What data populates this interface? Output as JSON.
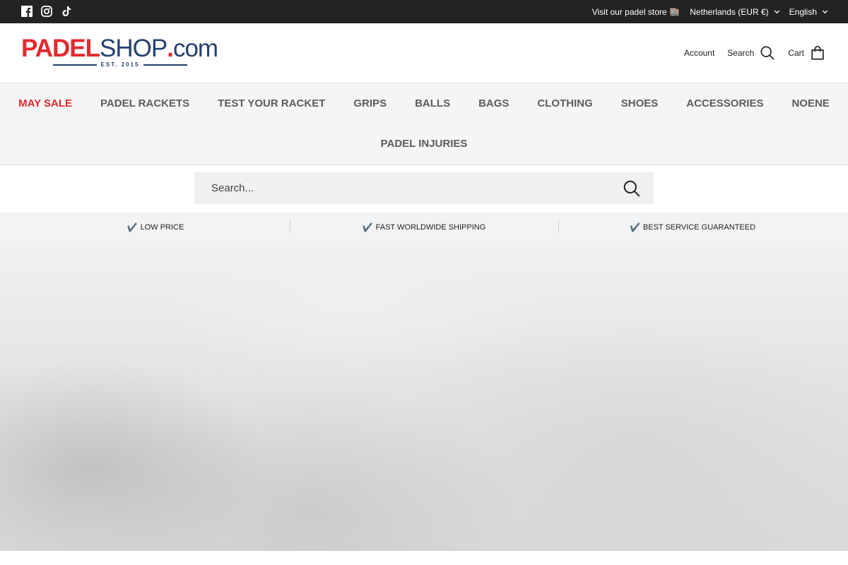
{
  "topbar": {
    "social": [
      "facebook-icon",
      "instagram-icon",
      "tiktok-icon"
    ],
    "store_link": "Visit our padel store",
    "store_emoji": "🏬",
    "country": "Netherlands (EUR €)",
    "language": "English"
  },
  "logo": {
    "padel": "PADEL",
    "shop": "SHOP",
    "dot": ".",
    "com": "com",
    "est": "EST. 2015"
  },
  "header": {
    "account": "Account",
    "search": "Search",
    "cart": "Cart"
  },
  "nav": {
    "row1": [
      "MAY SALE",
      "PADEL RACKETS",
      "TEST YOUR RACKET",
      "GRIPS",
      "BALLS",
      "BAGS",
      "CLOTHING",
      "SHOES",
      "ACCESSORIES",
      "NOENE"
    ],
    "row2": [
      "PADEL INJURIES"
    ]
  },
  "search": {
    "placeholder": "Search...",
    "value": ""
  },
  "usp": [
    "LOW PRICE",
    "FAST WORLDWIDE SHIPPING",
    "BEST SERVICE GUARANTEED"
  ],
  "usp_check": "✔️",
  "colors": {
    "brand_red": "#e12a2f",
    "brand_navy": "#26406e",
    "topbar_bg": "#232323",
    "nav_bg": "#f5f5f5"
  }
}
